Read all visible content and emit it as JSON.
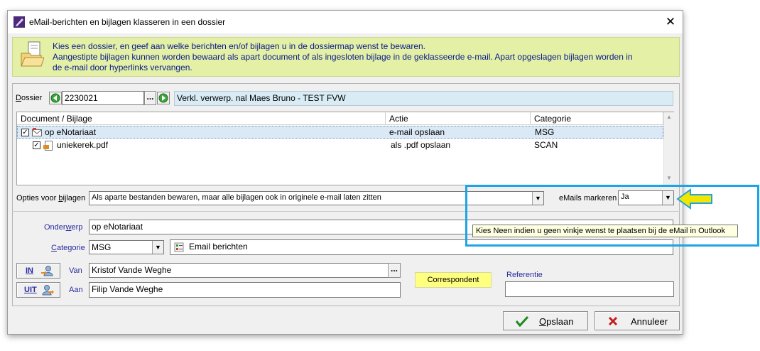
{
  "window": {
    "title": "eMail-berichten en bijlagen klasseren in een dossier",
    "close_glyph": "✕"
  },
  "banner": {
    "lines": [
      "Kies een dossier, en geef aan welke berichten en/of bijlagen u in de dossiermap wenst te bewaren.",
      "Aangestipte bijlagen kunnen worden bewaard als apart document of als ingesloten bijlage in de geklasseerde e-mail. Apart opgeslagen bijlagen worden in",
      "de e-mail door hyperlinks vervangen."
    ]
  },
  "dossier": {
    "label_first": "D",
    "label_rest": "ossier",
    "number": "2230021",
    "browse": "...",
    "description": "Verkl. verwerp. nal Maes Bruno - TEST FVW"
  },
  "table": {
    "columns": [
      "Document / Bijlage",
      "Actie",
      "Categorie"
    ],
    "rows": [
      {
        "name": "op eNotariaat",
        "action": "e-mail opslaan",
        "category": "MSG",
        "checked": true
      },
      {
        "name": "uniekerek.pdf",
        "action": "als .pdf opslaan",
        "category": "SCAN",
        "checked": true
      }
    ]
  },
  "options": {
    "label_pre": "Opties voor ",
    "label_u": "b",
    "label_post": "ijlagen",
    "value": "Als aparte bestanden bewaren, maar alle bijlagen ook in originele e-mail laten zitten",
    "mark_label": "eMails markeren",
    "mark_value": "Ja"
  },
  "tooltip": "Kies Neen indien u geen vinkje wenst te plaatsen  bij de eMail in Outlook",
  "subject": {
    "label_pre": "Onder",
    "label_u": "w",
    "label_post": "erp",
    "value": "op eNotariaat"
  },
  "category": {
    "label_u": "C",
    "label_post": "ategorie",
    "value": "MSG",
    "type_label": "Email berichten"
  },
  "from": {
    "in_button": "IN",
    "label": "Van",
    "value": "Kristof Vande Weghe",
    "browse": "...",
    "correspondent": "Correspondent"
  },
  "to": {
    "out_button": "UIT",
    "label": "Aan",
    "value": "Filip Vande Weghe"
  },
  "reference": {
    "label": "Referentie",
    "value": ""
  },
  "buttons": {
    "save_u": "O",
    "save_rest": "pslaan",
    "cancel": "Annuleer"
  },
  "colors": {
    "banner_bg": "#e3f0a6",
    "highlight": "#1ea3e6",
    "arrow": "#f2e600",
    "tooltip_bg": "#ffffe1"
  }
}
